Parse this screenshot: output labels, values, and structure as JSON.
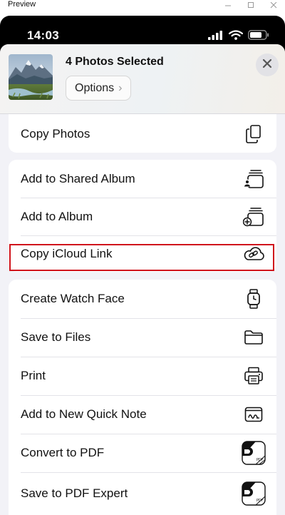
{
  "window": {
    "title": "Preview"
  },
  "status_bar": {
    "time": "14:03"
  },
  "header": {
    "title": "4 Photos Selected",
    "options_label": "Options"
  },
  "menu": {
    "group0": [
      {
        "label": "Copy Photos",
        "icon": "copy-photos-icon"
      }
    ],
    "group1": [
      {
        "label": "Add to Shared Album",
        "icon": "shared-album-icon"
      },
      {
        "label": "Add to Album",
        "icon": "add-album-icon"
      },
      {
        "label": "Copy iCloud Link",
        "icon": "icloud-link-icon"
      }
    ],
    "group2": [
      {
        "label": "Create Watch Face",
        "icon": "watch-icon"
      },
      {
        "label": "Save to Files",
        "icon": "folder-icon"
      },
      {
        "label": "Print",
        "icon": "printer-icon"
      },
      {
        "label": "Add to New Quick Note",
        "icon": "quick-note-icon"
      },
      {
        "label": "Convert to PDF",
        "icon": "pdf-icon"
      },
      {
        "label": "Save to PDF Expert",
        "icon": "pdf-expert-icon"
      }
    ]
  },
  "colors": {
    "highlight": "#d0141c",
    "sheet_bg": "#f2f2f7"
  }
}
